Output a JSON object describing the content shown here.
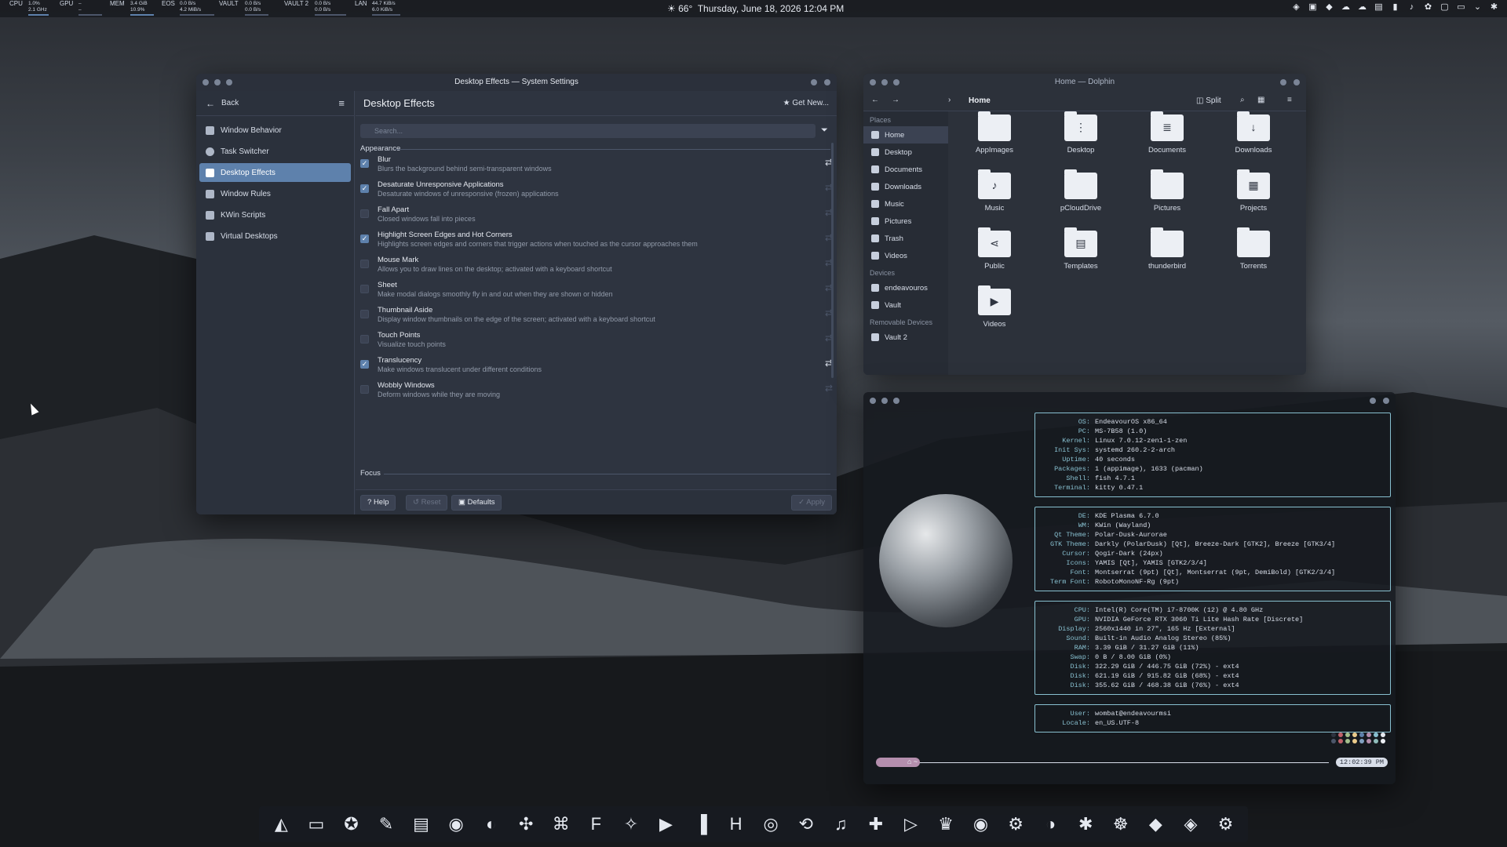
{
  "topbar": {
    "meters": [
      {
        "label": "CPU",
        "v1": "1.0%",
        "v2": "2.1 GHz"
      },
      {
        "label": "GPU",
        "v1": "–",
        "v2": "–"
      },
      {
        "label": "MEM",
        "v1": "3.4 GiB",
        "v2": "10.9%"
      },
      {
        "label": "EOS",
        "v1": "0.0 B/s",
        "v2": "4.2 MiB/s"
      },
      {
        "label": "VAULT",
        "v1": "0.0 B/s",
        "v2": "0.0 B/s"
      },
      {
        "label": "VAULT 2",
        "v1": "0.0 B/s",
        "v2": "0.0 B/s"
      },
      {
        "label": "LAN",
        "v1": "44.7 KiB/s",
        "v2": "6.0 KiB/s"
      }
    ],
    "weather": "66°",
    "datetime": "Thursday, June 18, 2026 12:04 PM",
    "tray_icons": [
      "shield-icon",
      "clipboard-icon",
      "vpn-icon",
      "cloud-icon",
      "cloud-icon",
      "network-icon",
      "battery-icon",
      "volume-icon",
      "gear-icon",
      "notes-icon",
      "display-icon",
      "chevron-icon",
      "settings-icon"
    ]
  },
  "settings": {
    "title": "Desktop Effects — System Settings",
    "back": "Back",
    "nav": [
      "Window Behavior",
      "Task Switcher",
      "Desktop Effects",
      "Window Rules",
      "KWin Scripts",
      "Virtual Desktops"
    ],
    "heading": "Desktop Effects",
    "get_new": "Get New...",
    "search_placeholder": "Search...",
    "section_appearance": "Appearance",
    "section_focus": "Focus",
    "effects": [
      {
        "name": "Blur",
        "desc": "Blurs the background behind semi-transparent windows",
        "checked": true,
        "configurable": true
      },
      {
        "name": "Desaturate Unresponsive Applications",
        "desc": "Desaturate windows of unresponsive (frozen) applications",
        "checked": true,
        "configurable": false
      },
      {
        "name": "Fall Apart",
        "desc": "Closed windows fall into pieces",
        "checked": false,
        "configurable": false
      },
      {
        "name": "Highlight Screen Edges and Hot Corners",
        "desc": "Highlights screen edges and corners that trigger actions when touched as the cursor approaches them",
        "checked": true,
        "configurable": false
      },
      {
        "name": "Mouse Mark",
        "desc": "Allows you to draw lines on the desktop; activated with a keyboard shortcut",
        "checked": false,
        "configurable": true
      },
      {
        "name": "Sheet",
        "desc": "Make modal dialogs smoothly fly in and out when they are shown or hidden",
        "checked": false,
        "configurable": false
      },
      {
        "name": "Thumbnail Aside",
        "desc": "Display window thumbnails on the edge of the screen; activated with a keyboard shortcut",
        "checked": false,
        "configurable": true
      },
      {
        "name": "Touch Points",
        "desc": "Visualize touch points",
        "checked": false,
        "configurable": false
      },
      {
        "name": "Translucency",
        "desc": "Make windows translucent under different conditions",
        "checked": true,
        "configurable": true
      },
      {
        "name": "Wobbly Windows",
        "desc": "Deform windows while they are moving",
        "checked": false,
        "configurable": true
      }
    ],
    "help": "Help",
    "reset": "Reset",
    "defaults": "Defaults",
    "apply": "Apply"
  },
  "dolphin": {
    "title": "Home — Dolphin",
    "breadcrumb": "Home",
    "split": "Split",
    "places_header": "Places",
    "places": [
      "Home",
      "Desktop",
      "Documents",
      "Downloads",
      "Music",
      "Pictures",
      "Trash",
      "Videos"
    ],
    "devices_header": "Devices",
    "devices": [
      "endeavouros",
      "Vault"
    ],
    "removable_header": "Removable Devices",
    "removable": [
      "Vault 2"
    ],
    "files": [
      "AppImages",
      "Desktop",
      "Documents",
      "Downloads",
      "Music",
      "pCloudDrive",
      "Pictures",
      "Projects",
      "Public",
      "Templates",
      "thunderbird",
      "Torrents",
      "Videos"
    ]
  },
  "terminal": {
    "sys": [
      [
        "OS:",
        "EndeavourOS x86_64"
      ],
      [
        "PC:",
        "MS-7B58 (1.0)"
      ],
      [
        "Kernel:",
        "Linux 7.0.12-zen1-1-zen"
      ],
      [
        "Init Sys:",
        "systemd 260.2-2-arch"
      ],
      [
        "Uptime:",
        "40 seconds"
      ],
      [
        "Packages:",
        "1 (appimage), 1633 (pacman)"
      ],
      [
        "Shell:",
        "fish 4.7.1"
      ],
      [
        "Terminal:",
        "kitty 0.47.1"
      ]
    ],
    "de": [
      [
        "DE:",
        "KDE Plasma 6.7.0"
      ],
      [
        "WM:",
        "KWin (Wayland)"
      ],
      [
        "Qt Theme:",
        "Polar-Dusk-Aurorae"
      ],
      [
        "GTK Theme:",
        "Darkly (PolarDusk) [Qt], Breeze-Dark [GTK2], Breeze [GTK3/4]"
      ],
      [
        "Cursor:",
        "Qogir-Dark (24px)"
      ],
      [
        "Icons:",
        "YAMIS [Qt], YAMIS [GTK2/3/4]"
      ],
      [
        "Font:",
        "Montserrat (9pt) [Qt], Montserrat (9pt, DemiBold) [GTK2/3/4]"
      ],
      [
        "Term Font:",
        "RobotoMonoNF-Rg (9pt)"
      ]
    ],
    "hw": [
      [
        "CPU:",
        "Intel(R) Core(TM) i7-8700K (12) @ 4.80 GHz"
      ],
      [
        "GPU:",
        "NVIDIA GeForce RTX 3060 Ti Lite Hash Rate [Discrete]"
      ],
      [
        "Display:",
        "2560x1440 in 27\", 165 Hz [External]"
      ],
      [
        "Sound:",
        "Built-in Audio Analog Stereo (85%)"
      ],
      [
        "RAM:",
        "3.39 GiB / 31.27 GiB (11%)"
      ],
      [
        "Swap:",
        "0 B / 8.00 GiB (0%)"
      ],
      [
        "Disk:",
        "322.29 GiB / 446.75 GiB (72%) - ext4"
      ],
      [
        "Disk:",
        "621.19 GiB / 915.82 GiB (68%) - ext4"
      ],
      [
        "Disk:",
        "355.62 GiB / 468.38 GiB (76%) - ext4"
      ]
    ],
    "user": [
      [
        "User:",
        "wombat@endeavourmsi"
      ],
      [
        "Locale:",
        "en_US.UTF-8"
      ]
    ],
    "prompt": "⌂ ~",
    "time": "12:02:39 PM"
  },
  "dock_icons": [
    "endeavour-icon",
    "files-icon",
    "gimp-icon",
    "editor-icon",
    "document-icon",
    "browser-icon",
    "thunderbird-icon",
    "krita-icon",
    "puzzle-icon",
    "font-icon",
    "inkscape-icon",
    "video-editor-icon",
    "columns-icon",
    "kdenlive-icon",
    "obs-icon",
    "media-icon",
    "music-icon",
    "plus-icon",
    "player-icon",
    "game-icon",
    "discord-icon",
    "steam-icon",
    "qbittorrent-icon",
    "network-icon",
    "wireguard-icon",
    "brave-icon",
    "feather-icon",
    "settings-icon"
  ]
}
